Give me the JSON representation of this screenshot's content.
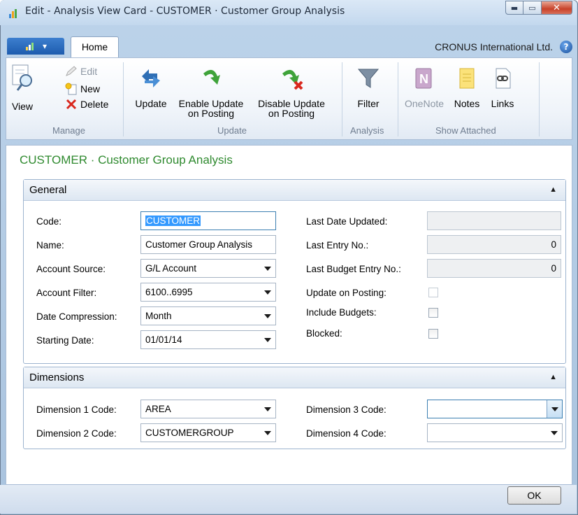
{
  "window": {
    "title": "Edit - Analysis View Card - CUSTOMER · Customer Group Analysis",
    "min_glyph": "▬",
    "max_glyph": "▭",
    "close_glyph": "✕"
  },
  "ribbon": {
    "app_button_glyph": "▾",
    "tab_home": "Home",
    "company": "CRONUS International Ltd.",
    "help_glyph": "?",
    "groups": {
      "manage": {
        "label": "Manage",
        "view": "View",
        "edit": "Edit",
        "new": "New",
        "delete": "Delete"
      },
      "update": {
        "label": "Update",
        "update": "Update",
        "enable_line1": "Enable Update",
        "enable_line2": "on Posting",
        "disable_line1": "Disable Update",
        "disable_line2": "on Posting"
      },
      "analysis": {
        "label": "Analysis",
        "filter": "Filter"
      },
      "show_attached": {
        "label": "Show Attached",
        "onenote": "OneNote",
        "notes": "Notes",
        "links": "Links"
      }
    }
  },
  "page": {
    "title": "CUSTOMER · Customer Group Analysis"
  },
  "general": {
    "header": "General",
    "code_label": "Code:",
    "code_value": "CUSTOMER",
    "name_label": "Name:",
    "name_value": "Customer Group Analysis",
    "account_source_label": "Account Source:",
    "account_source_value": "G/L Account",
    "account_filter_label": "Account Filter:",
    "account_filter_value": "6100..6995",
    "date_compression_label": "Date Compression:",
    "date_compression_value": "Month",
    "starting_date_label": "Starting Date:",
    "starting_date_value": "01/01/14",
    "last_date_updated_label": "Last Date Updated:",
    "last_date_updated_value": "",
    "last_entry_no_label": "Last Entry No.:",
    "last_entry_no_value": "0",
    "last_budget_entry_no_label": "Last Budget Entry No.:",
    "last_budget_entry_no_value": "0",
    "update_on_posting_label": "Update on Posting:",
    "update_on_posting_checked": false,
    "include_budgets_label": "Include Budgets:",
    "include_budgets_checked": false,
    "blocked_label": "Blocked:",
    "blocked_checked": false
  },
  "dimensions": {
    "header": "Dimensions",
    "dim1_label": "Dimension 1 Code:",
    "dim1_value": "AREA",
    "dim2_label": "Dimension 2 Code:",
    "dim2_value": "CUSTOMERGROUP",
    "dim3_label": "Dimension 3 Code:",
    "dim3_value": "",
    "dim4_label": "Dimension 4 Code:",
    "dim4_value": ""
  },
  "footer": {
    "ok": "OK"
  },
  "colors": {
    "page_title": "#2f8a2f",
    "selection": "#3399ff",
    "close_button": "#c8422a"
  }
}
